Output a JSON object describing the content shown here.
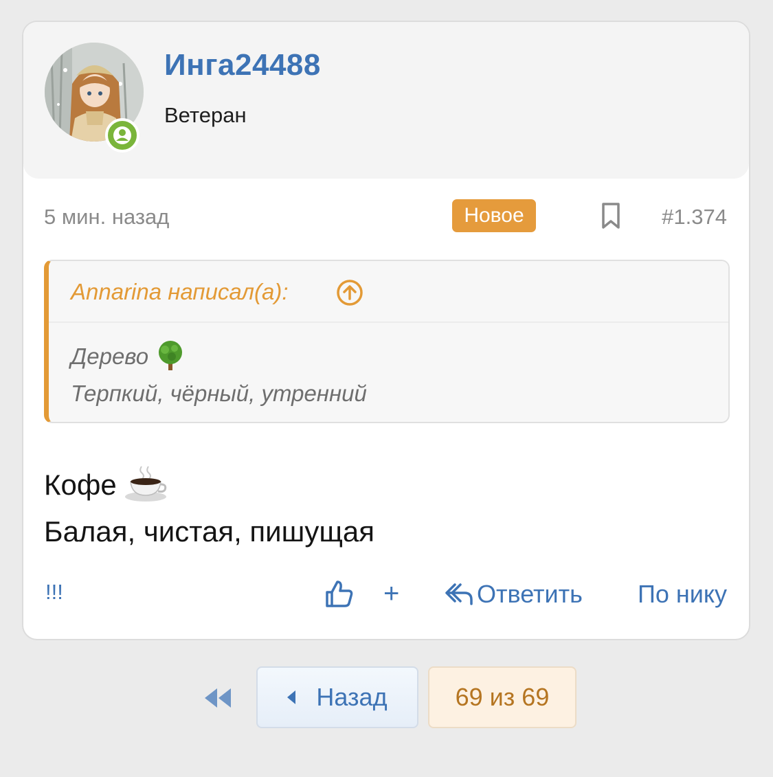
{
  "user": {
    "name": "Инга24488",
    "title": "Ветеран",
    "online": true
  },
  "meta": {
    "time": "5 мин. назад",
    "badge": "Новое",
    "post_number": "#1.374"
  },
  "quote": {
    "author": "Annarina написал(а):",
    "lines": [
      "Дерево",
      "Терпкий, чёрный, утренний"
    ]
  },
  "message": {
    "lines": [
      "Кофе",
      "Балая, чистая, пишущая"
    ]
  },
  "actions": {
    "warn": "!!!",
    "plus": "+",
    "reply": "Ответить",
    "by_nick": "По нику"
  },
  "pager": {
    "back": "Назад",
    "current": "69 из 69"
  },
  "colors": {
    "link": "#3d73b5",
    "accent": "#e39a36",
    "online": "#7ab53b"
  }
}
